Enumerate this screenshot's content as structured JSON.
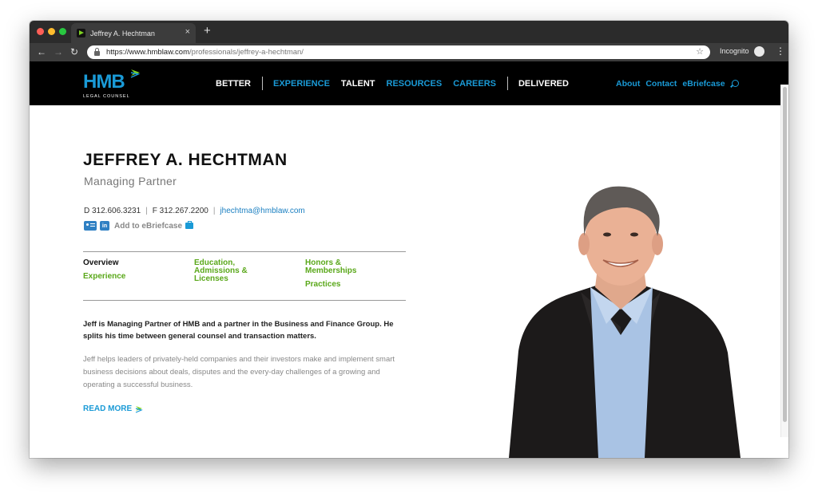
{
  "browser": {
    "tab_title": "Jeffrey A. Hechtman",
    "tab_close": "×",
    "new_tab": "+",
    "url_host": "https://www.hmblaw.com",
    "url_path": "/professionals/jeffrey-a-hechtman/",
    "mode_label": "Incognito",
    "back": "←",
    "forward": "→",
    "reload": "↻",
    "star": "☆",
    "menu": "⋮"
  },
  "site": {
    "logo_text": "HMB",
    "logo_sub": "LEGAL COUNSEL",
    "nav": [
      {
        "label": "BETTER"
      },
      {
        "label": "EXPERIENCE"
      },
      {
        "label": "TALENT"
      },
      {
        "label": "RESOURCES"
      },
      {
        "label": "CAREERS"
      },
      {
        "label": "DELIVERED"
      }
    ],
    "util_nav": [
      {
        "label": "About"
      },
      {
        "label": "Contact"
      },
      {
        "label": "eBriefcase"
      }
    ]
  },
  "profile": {
    "name": "JEFFREY A. HECHTMAN",
    "title": "Managing Partner",
    "direct": "D 312.606.3231",
    "fax": "F 312.267.2200",
    "separator": "|",
    "email": "jhechtma@hmblaw.com",
    "linkedin_label": "in",
    "add_briefcase": "Add to eBriefcase",
    "tabs": [
      {
        "label": "Overview"
      },
      {
        "label": "Experience"
      },
      {
        "label": "Education, Admissions & Licenses"
      },
      {
        "label": "Honors & Memberships"
      },
      {
        "label": "Practices"
      }
    ],
    "intro": "Jeff is Managing Partner of HMB and a partner in the Business and Finance Group. He splits his time between general counsel and transaction matters.",
    "body": "Jeff helps leaders of privately-held companies and their investors make and implement smart business decisions about deals, disputes and the every-day challenges of a growing and operating a successful business.",
    "read_more": "READ MORE"
  },
  "colors": {
    "brand_blue": "#1a9ad6",
    "brand_green": "#5aa81a",
    "header_bg": "#000000"
  }
}
